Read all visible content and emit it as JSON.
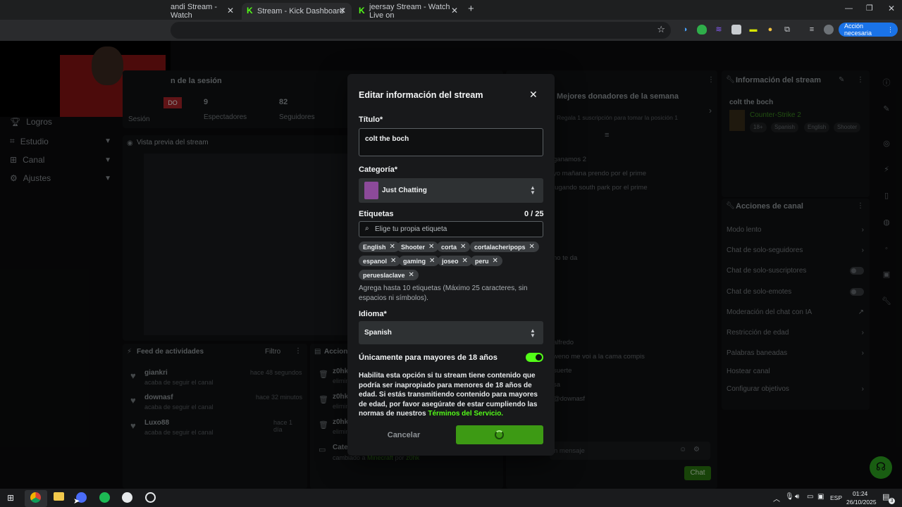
{
  "browser": {
    "tabs": [
      {
        "title": "andi Stream - Watch"
      },
      {
        "title": "Stream - Kick Dashboard"
      },
      {
        "title": "jeersay Stream - Watch Live on"
      }
    ],
    "new_tab": "+",
    "action_needed": "Acción necesaria"
  },
  "sidebar": {
    "items": [
      {
        "label": "Logros",
        "icon": "trophy-icon"
      },
      {
        "label": "Estudio",
        "icon": "studio-icon"
      },
      {
        "label": "Canal",
        "icon": "channel-icon"
      },
      {
        "label": "Ajustes",
        "icon": "gear-icon"
      }
    ]
  },
  "session": {
    "title": "n de la sesión",
    "badge": "DO",
    "session_label": "Sesión",
    "viewers_value": "9",
    "viewers_label": "Espectadores",
    "followers_value": "82",
    "followers_label": "Seguidores"
  },
  "preview": {
    "title": "Vista previa del stream"
  },
  "feed": {
    "title": "Feed de actividades",
    "filter": "Filtro",
    "items": [
      {
        "user": "giankri",
        "action": "acaba de seguir el canal",
        "time": "hace 48 segundos"
      },
      {
        "user": "downasf",
        "action": "acaba de seguir el canal",
        "time": "hace 32 minutos"
      },
      {
        "user": "Luxo88",
        "action": "acaba de seguir el canal",
        "time": "hace 1 día"
      }
    ]
  },
  "actions_col": {
    "title": "Accion",
    "rows": [
      {
        "user": "z0hk",
        "sub": "elimin"
      },
      {
        "user": "z0hk",
        "sub": "elimin"
      },
      {
        "user": "z0hk",
        "sub": "elimin"
      },
      {
        "user": "Cate",
        "sub": "cambiado a",
        "game": "Minecraft",
        "by": "por",
        "who": "z0hk"
      }
    ]
  },
  "donors": {
    "title": "Mejores donadores de la semana",
    "subtitle": "Regala 1 suscripción para tomar la posición 1"
  },
  "chat": {
    "lines": [
      "ganamos 2",
      "yo mañana prendo por el prime",
      "jugando south park por el prime",
      "no te da",
      "alfredo",
      "weno me voi a la cama compis",
      "suerte",
      "sa",
      "@downasf"
    ],
    "input_placeholder": "n mensaje",
    "send": "Chat"
  },
  "stream_info": {
    "title": "Información del stream",
    "stream_title": "colt the boch",
    "category": "Counter-Strike 2",
    "tags": [
      "18+",
      "Spanish",
      "English",
      "Shooter"
    ]
  },
  "channel_actions": {
    "title": "Acciones de canal",
    "items": [
      {
        "label": "Modo lento",
        "kind": "arrow"
      },
      {
        "label": "Chat de solo-seguidores",
        "kind": "arrow"
      },
      {
        "label": "Chat de solo-suscriptores",
        "kind": "toggle"
      },
      {
        "label": "Chat de solo-emotes",
        "kind": "toggle"
      },
      {
        "label": "Moderación del chat con IA",
        "kind": "ext"
      },
      {
        "label": "Restricción de edad",
        "kind": "arrow"
      },
      {
        "label": "Palabras baneadas",
        "kind": "arrow"
      },
      {
        "label": "Hostear canal",
        "kind": "none"
      },
      {
        "label": "Configurar objetivos",
        "kind": "arrow"
      }
    ]
  },
  "modal": {
    "title": "Editar información del stream",
    "title_label": "Título*",
    "title_value": "colt the boch",
    "category_label": "Categoría*",
    "category_value": "Just Chatting",
    "tags_label": "Etiquetas",
    "tags_count": "0 / 25",
    "tags_placeholder": "Elige tu propia etiqueta",
    "tags": [
      "English",
      "Shooter",
      "corta",
      "cortalacheripops",
      "espanol",
      "gaming",
      "joseo",
      "peru",
      "perueslaclave"
    ],
    "tags_help": "Agrega hasta 10 etiquetas (Máximo 25 caracteres, sin espacios ni símbolos).",
    "language_label": "Idioma*",
    "language_value": "Spanish",
    "adult_label": "Únicamente para mayores de 18 años",
    "adult_on": true,
    "adult_help": "Habilita esta opción si tu stream tiene contenido que podría ser inapropiado para menores de 18 años de edad. Si estás transmitiendo contenido para mayores de edad, por favor asegúrate de estar cumpliendo las normas de nuestros",
    "terms_link": "Términos del Servicio.",
    "cancel": "Cancelar",
    "accent": "#53fc18"
  },
  "taskbar": {
    "lang": "ESP",
    "time": "01:24",
    "date": "26/10/2025",
    "notif": "3"
  }
}
